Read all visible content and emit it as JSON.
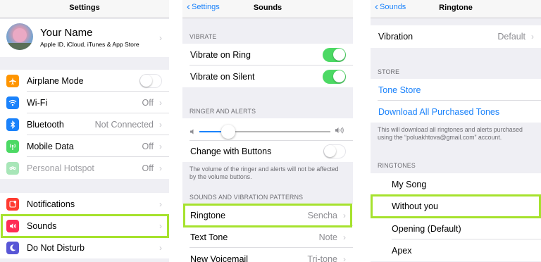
{
  "colors": {
    "accent_blue": "#1a82fb",
    "highlight_green": "#a6e22e",
    "toggle_green": "#4cd964"
  },
  "settings": {
    "nav_title": "Settings",
    "profile": {
      "name": "Your Name",
      "subtitle": "Apple ID, iCloud, iTunes & App Store"
    },
    "items": [
      {
        "label": "Airplane Mode",
        "value": "",
        "icon": "airplane-icon",
        "icon_color": "#ff9500",
        "control": "toggle-off"
      },
      {
        "label": "Wi-Fi",
        "value": "Off",
        "icon": "wifi-icon",
        "icon_color": "#1a82fb"
      },
      {
        "label": "Bluetooth",
        "value": "Not Connected",
        "icon": "bluetooth-icon",
        "icon_color": "#1a82fb"
      },
      {
        "label": "Mobile Data",
        "value": "Off",
        "icon": "antenna-icon",
        "icon_color": "#4cd964"
      },
      {
        "label": "Personal Hotspot",
        "value": "Off",
        "icon": "hotspot-icon",
        "icon_color": "#a8e6b8",
        "disabled": true
      },
      {
        "label": "Notifications",
        "value": "",
        "icon": "notifications-icon",
        "icon_color": "#ff3b30"
      },
      {
        "label": "Sounds",
        "value": "",
        "icon": "speaker-icon",
        "icon_color": "#ff2d55",
        "highlighted": true
      },
      {
        "label": "Do Not Disturb",
        "value": "",
        "icon": "moon-icon",
        "icon_color": "#5856d6"
      }
    ]
  },
  "sounds": {
    "back_label": "Settings",
    "nav_title": "Sounds",
    "vibrate_header": "VIBRATE",
    "vibrate_on_ring": "Vibrate on Ring",
    "vibrate_on_silent": "Vibrate on Silent",
    "ringer_header": "RINGER AND ALERTS",
    "ringer_volume": 0.22,
    "change_with_buttons": "Change with Buttons",
    "ringer_footer": "The volume of the ringer and alerts will not be affected by the volume buttons.",
    "patterns_header": "SOUNDS AND VIBRATION PATTERNS",
    "ringtone_label": "Ringtone",
    "ringtone_value": "Sencha",
    "text_tone_label": "Text Tone",
    "text_tone_value": "Note",
    "new_voicemail_label": "New Voicemail",
    "new_voicemail_value": "Tri-tone"
  },
  "ringtone": {
    "back_label": "Sounds",
    "nav_title": "Ringtone",
    "vibration_label": "Vibration",
    "vibration_value": "Default",
    "store_header": "STORE",
    "tone_store": "Tone Store",
    "download_all": "Download All Purchased Tones",
    "store_footer": "This will download all ringtones and alerts purchased using the “poluakhtova@gmail.com” account.",
    "ringtones_header": "RINGTONES",
    "tones": [
      "My Song",
      "Without you",
      "Opening (Default)",
      "Apex"
    ]
  }
}
